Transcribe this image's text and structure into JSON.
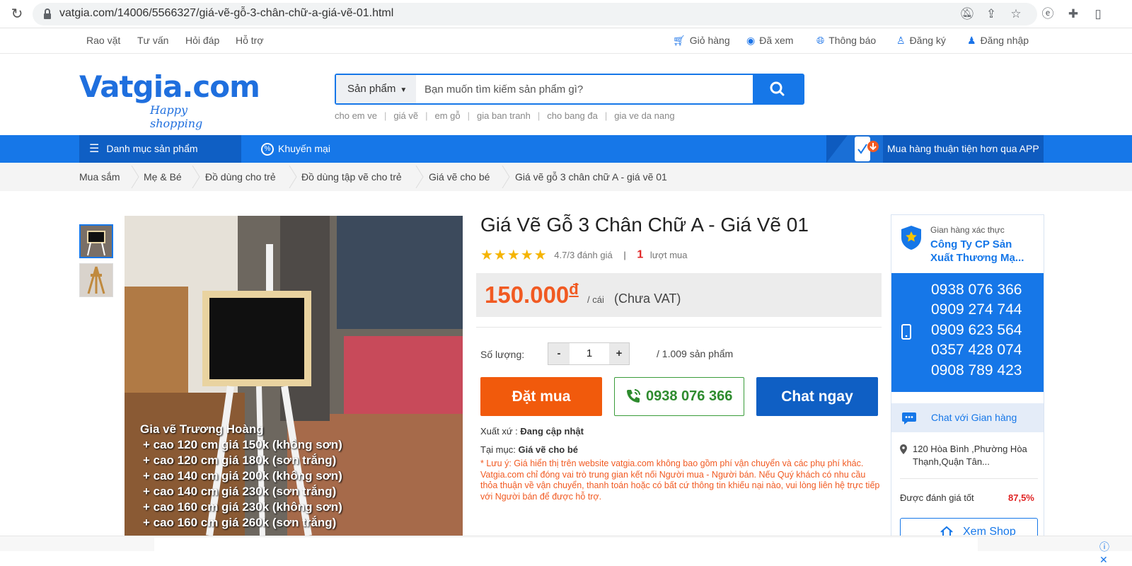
{
  "browser": {
    "url": "vatgia.com/14006/5566327/giá-vẽ-gỗ-3-chân-chữ-a-giá-vẽ-01.html"
  },
  "top_links": {
    "left": [
      "Rao vặt",
      "Tư vấn",
      "Hỏi đáp",
      "Hỗ trợ"
    ],
    "cart": "Giỏ hàng",
    "viewed": "Đã xem",
    "notify": "Thông báo",
    "register": "Đăng ký",
    "login": "Đăng nhập"
  },
  "logo": {
    "main": "Vatgia.com",
    "tagline": "Happy shopping"
  },
  "search": {
    "category": "Sản phẩm",
    "placeholder": "Bạn muốn tìm kiếm sản phẩm gì?",
    "hints": [
      "cho em ve",
      "giá vẽ",
      "em gỗ",
      "gia ban tranh",
      "cho bang đa",
      "gia ve da nang"
    ]
  },
  "nav": {
    "categories": "Danh mục sản phẩm",
    "promo": "Khuyến mại",
    "app": "Mua hàng thuận tiện hơn qua APP"
  },
  "breadcrumb": [
    "Mua sắm",
    "Mẹ & Bé",
    "Đồ dùng cho trẻ",
    "Đồ dùng tập vẽ cho trẻ",
    "Giá vẽ cho bé",
    "Giá vẽ gỗ 3 chân chữ A - giá vẽ 01"
  ],
  "image_overlay": [
    "Gia vẽ Trương Hoàng",
    "+ cao 120 cm giá 150k (không sơn)",
    "+ cao 120 cm giá 180k (sơn trắng)",
    "+ cao 140 cm giá 200k (không sơn)",
    "+ cao 140 cm giá 230k (sơn trắng)",
    "+ cao 160 cm giá 230k (không sơn)",
    "+ cao 160 cm giá 260k (sơn trắng)"
  ],
  "product": {
    "title": "Giá Vẽ Gỗ 3 Chân Chữ A - Giá Vẽ 01",
    "stars": 4.7,
    "rating_text": "4.7/3 đánh giá",
    "purchases": "1",
    "purchases_label": "lượt mua",
    "price": "150.000",
    "currency": "đ",
    "unit": "/ cái",
    "vat": "(Chưa VAT)",
    "qty_label": "Số lượng:",
    "qty_minus": "-",
    "qty": "1",
    "qty_plus": "+",
    "stock": "/ 1.009 sản phẩm",
    "buy": "Đặt mua",
    "phone": "0938 076 366",
    "chat": "Chat ngay",
    "origin_label": "Xuất xứ :",
    "origin_value": "Đang cập nhật",
    "category_label": "Tại mục:",
    "category_value": "Giá vẽ cho bé",
    "note": "* Lưu ý: Giá hiển thị trên website vatgia.com không bao gồm phí vận chuyển và các phụ phí khác. Vatgia.com chỉ đóng vai trò trung gian kết nối Người mua - Người bán. Nếu Quý khách có nhu cầu thỏa thuận về vận chuyển, thanh toán hoặc có bất cứ thông tin khiếu nại nào, vui lòng liên hệ trực tiếp với Người bán để được hỗ trợ."
  },
  "shop": {
    "verified": "Gian hàng xác thực",
    "name": "Công Ty CP Sản Xuất Thương Mạ...",
    "phones": [
      "0938 076 366",
      "0909 274 744",
      "0909 623 564",
      "0357 428 074",
      "0908 789 423"
    ],
    "chat": "Chat với Gian hàng",
    "address": "120 Hòa Bình ,Phường Hòa Thạnh,Quận Tân...",
    "rating_label": "Được đánh giá tốt",
    "rating_value": "87,5%",
    "view_shop": "Xem Shop"
  },
  "colors": {
    "brand": "#1677e8",
    "brand_dark": "#0f5fc4",
    "price": "#f15a22",
    "buy": "#f15a0c",
    "call": "#2e8b2e"
  }
}
